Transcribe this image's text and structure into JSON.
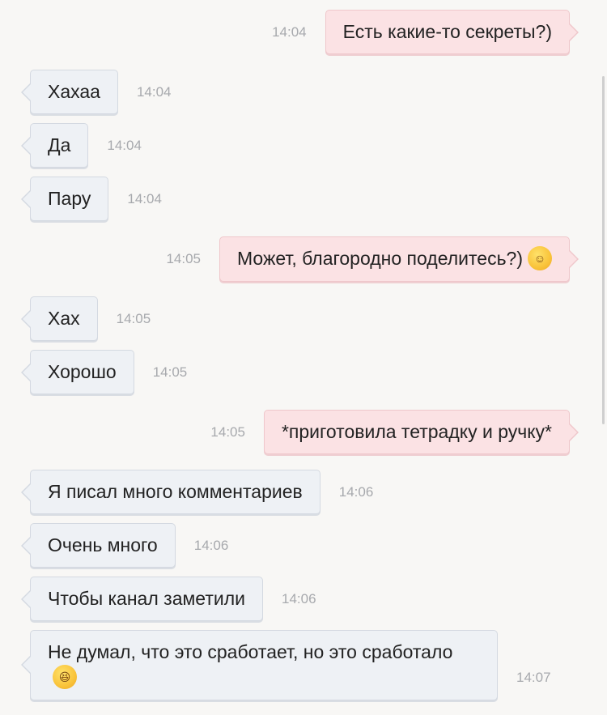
{
  "messages": [
    {
      "text": "Есть какие-то секреты?)",
      "time": "14:04"
    },
    {
      "text": "Хахаа",
      "time": "14:04"
    },
    {
      "text": "Да",
      "time": "14:04"
    },
    {
      "text": "Пару",
      "time": "14:04"
    },
    {
      "text": "Может, благородно поделитесь?)",
      "time": "14:05",
      "emoji": "☺"
    },
    {
      "text": "Хах",
      "time": "14:05"
    },
    {
      "text": "Хорошо",
      "time": "14:05"
    },
    {
      "text": "*приготовила тетрадку и ручку*",
      "time": "14:05"
    },
    {
      "text": "Я писал много комментариев",
      "time": "14:06"
    },
    {
      "text": "Очень много",
      "time": "14:06"
    },
    {
      "text": "Чтобы канал заметили",
      "time": "14:06"
    },
    {
      "text": "Не думал, что это сработает, но это сработало",
      "time": "14:07",
      "emoji": "😆"
    }
  ]
}
